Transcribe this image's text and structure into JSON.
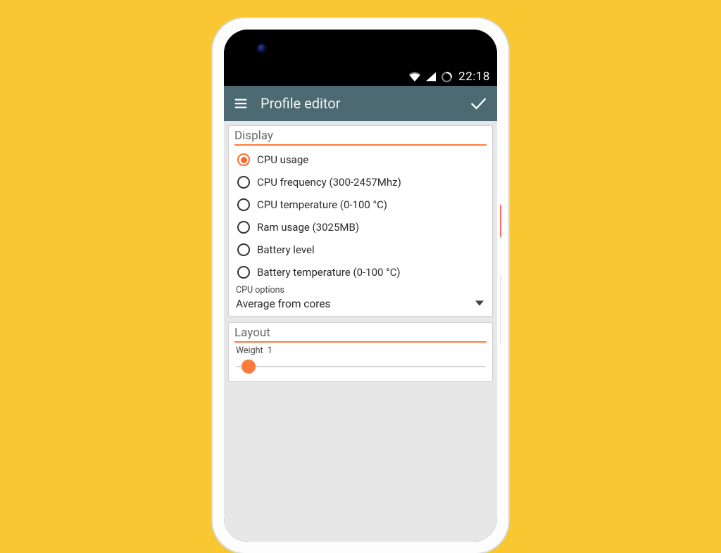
{
  "status": {
    "time": "22:18"
  },
  "appbar": {
    "title": "Profile editor"
  },
  "display": {
    "header": "Display",
    "options": [
      "CPU usage",
      "CPU frequency (300-2457Mhz)",
      "CPU temperature (0-100 °C)",
      "Ram usage (3025MB)",
      "Battery level",
      "Battery temperature (0-100 °C)"
    ],
    "selected_index": 0,
    "cpu_options_label": "CPU options",
    "cpu_options_value": "Average from cores"
  },
  "layout": {
    "header": "Layout",
    "weight_label": "Weight",
    "weight_value": "1"
  }
}
